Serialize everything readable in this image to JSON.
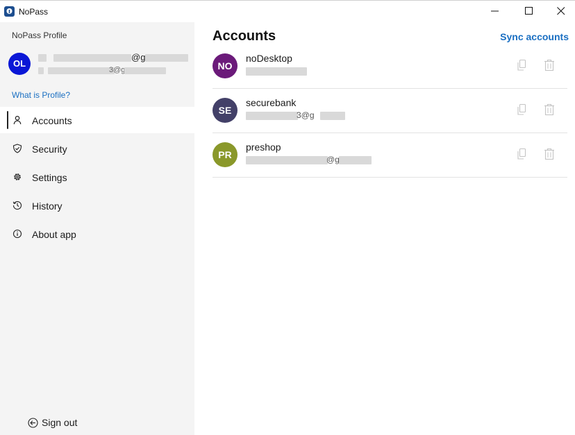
{
  "window": {
    "title": "NoPass"
  },
  "sidebar": {
    "profile_label": "NoPass Profile",
    "avatar_initials": "OL",
    "avatar_color": "#0a17d6",
    "user_line1_fragment": "@g",
    "user_line2_fragment": "3@g",
    "what_is_profile": "What is Profile?",
    "nav": [
      {
        "label": "Accounts",
        "icon": "person-icon",
        "active": true
      },
      {
        "label": "Security",
        "icon": "shield-icon",
        "active": false
      },
      {
        "label": "Settings",
        "icon": "gear-icon",
        "active": false
      },
      {
        "label": "History",
        "icon": "history-icon",
        "active": false
      },
      {
        "label": "About app",
        "icon": "info-icon",
        "active": false
      }
    ],
    "sign_out": "Sign out"
  },
  "main": {
    "title": "Accounts",
    "sync_label": "Sync accounts",
    "accounts": [
      {
        "initials": "NO",
        "name": "noDesktop",
        "color": "#6b1a7a",
        "sub_fragment": ""
      },
      {
        "initials": "SE",
        "name": "securebank",
        "color": "#434068",
        "sub_fragment": "3@g"
      },
      {
        "initials": "PR",
        "name": "preshop",
        "color": "#8a982a",
        "sub_fragment": "@g"
      }
    ]
  },
  "colors": {
    "accent": "#1a6fc2",
    "sidebar_bg": "#f4f4f4"
  }
}
